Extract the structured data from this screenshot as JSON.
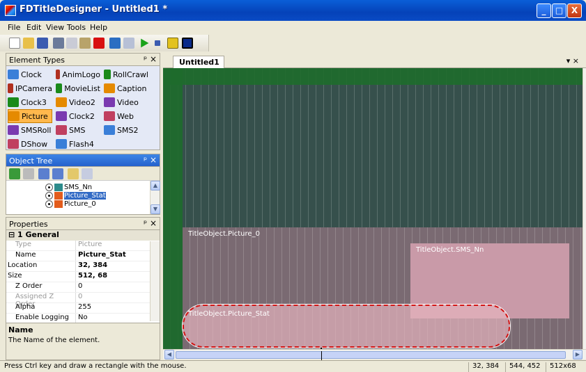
{
  "window": {
    "title": "FDTitleDesigner - Untitled1 *",
    "min": "_",
    "max": "□",
    "close": "X"
  },
  "menu": [
    "File",
    "Edit",
    "View",
    "Tools",
    "Help"
  ],
  "element_types": {
    "title": "Element Types",
    "items": [
      [
        "Clock",
        "AnimLogo",
        "RollCrawl"
      ],
      [
        "IPCamera",
        "MovieList",
        "Caption"
      ],
      [
        "Clock3",
        "Video2",
        "Video"
      ],
      [
        "Picture",
        "Clock2",
        "Web"
      ],
      [
        "SMSRoll",
        "SMS",
        "SMS2"
      ],
      [
        "DShow",
        "Flash4",
        ""
      ]
    ]
  },
  "object_tree": {
    "title": "Object Tree",
    "items": [
      "SMS_Nn",
      "Picture_Stat",
      "Picture_0"
    ]
  },
  "properties": {
    "title": "Properties",
    "section": "1 General",
    "rows": [
      {
        "k": "Type",
        "v": "Picture"
      },
      {
        "k": "Name",
        "v": "Picture_Stat"
      },
      {
        "k": "Location",
        "v": "32, 384"
      },
      {
        "k": "Size",
        "v": "512, 68"
      },
      {
        "k": "Z Order",
        "v": "0"
      },
      {
        "k": "Assigned Z Order",
        "v": "0"
      },
      {
        "k": "Alpha",
        "v": "255"
      },
      {
        "k": "Enable Logging",
        "v": "No"
      }
    ],
    "desc_title": "Name",
    "desc_text": "The Name of the element."
  },
  "doc_tab": "Untitled1 *",
  "canvas_labels": {
    "picture0": "TitleObject.Picture_0",
    "sms": "TitleObject.SMS_Nn",
    "stat": "TitleObject.Picture_Stat"
  },
  "status": {
    "hint": "Press Ctrl key and draw a rectangle with the mouse.",
    "location": "32, 384",
    "cursor": "544, 452",
    "size": "512x68"
  },
  "colors": {
    "selected_item": "#ffb84d",
    "titlebar": "#0a5fd8",
    "canvas": "#36504c",
    "border_green": "#1e6b2c"
  },
  "panel_ctrls": {
    "pin_close": "ᵖ ×"
  }
}
